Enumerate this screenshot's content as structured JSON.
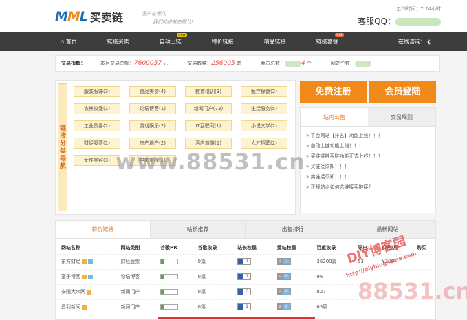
{
  "header": {
    "logo_mark": "MML",
    "logo_text": "买卖链",
    "slogan_line1": "客户在哪儿",
    "slogan_line2": "我们链接就在哪儿!",
    "worktime": "工作时间：7:24小时",
    "service_label": "客服QQ："
  },
  "nav": {
    "items": [
      {
        "label": "首页"
      },
      {
        "label": "链接买卖",
        "badge": ""
      },
      {
        "label": "自动上链",
        "badge": "new"
      },
      {
        "label": "特价链接"
      },
      {
        "label": "精品链接"
      },
      {
        "label": "链接套餐",
        "badge": "hot"
      }
    ],
    "online_consult": "在线咨询："
  },
  "stats": {
    "label": "交易指数：",
    "total_label": "本月交易总额：",
    "total_value": "7600057",
    "total_unit": "元",
    "count_label": "交易数量：",
    "count_value": "256005",
    "count_unit": "笔",
    "members_label": "会员总数：",
    "members_value": "4",
    "members_unit": "个",
    "sites_label": "网站个数："
  },
  "categories": {
    "label": "链接分类导航",
    "items": [
      "服装服饰(3)",
      "食品美食(4)",
      "教育培训(3)",
      "医疗保健(2)",
      "农林牧渔(1)",
      "论坛博客(1)",
      "新闻门户(73)",
      "生活服务(5)",
      "工业贸易(2)",
      "游戏娱乐(2)",
      "IT互联网(1)",
      "小说文学(2)",
      "财经股票(1)",
      "房产地产(2)",
      "酒店旅游(1)",
      "人才招聘(2)",
      "女性美容(3)",
      "电影影视(1)"
    ]
  },
  "auth": {
    "register": "免费注册",
    "login": "会员登陆"
  },
  "notice": {
    "tabs": [
      "站内公告",
      "交易规则"
    ],
    "items": [
      "平台网站【排名】功能上线！！！",
      "自动上链功能上线！！！",
      "买链链链买链功能正式上线！！！",
      "买链接须知！！！",
      "卖链接须知！！！",
      "正规站点如何选链接买链接？"
    ]
  },
  "panel": {
    "tabs": [
      "特价链接",
      "站长推荐",
      "出售排行",
      "最新网站"
    ],
    "columns": [
      "网站名称",
      "网站类别",
      "谷歌PR",
      "谷歌收录",
      "站长权重",
      "爱站权重",
      "百度收录",
      "导出",
      "价格/月",
      "购买"
    ],
    "rows": [
      {
        "name": "东方财经",
        "category": "财经股票",
        "google_index": "0篇",
        "zz_weight": "1",
        "az_weight": "2",
        "baidu": "36200篇",
        "out": "53",
        "price": "¥300"
      },
      {
        "name": "蛮子博客",
        "category": "论坛博客",
        "google_index": "0篇",
        "zz_weight": "1",
        "az_weight": "0",
        "baidu": "96",
        "out": "",
        "price": ""
      },
      {
        "name": "安阳大众网",
        "category": "新闻门户",
        "google_index": "0篇",
        "zz_weight": "0",
        "az_weight": "0",
        "baidu": "827",
        "out": "",
        "price": ""
      },
      {
        "name": "昌利新闻",
        "category": "新闻门户",
        "google_index": "0篇",
        "zz_weight": "1",
        "az_weight": "0",
        "baidu": "63篇",
        "out": "",
        "price": ""
      }
    ]
  },
  "watermark": {
    "text": "www.88531.cn",
    "text2": "88531.cn",
    "stamp_main": "DIY博客园",
    "stamp_url": "http://diyblogsome.com"
  },
  "colors": {
    "accent": "#f28a1b",
    "nav_bg": "#3d3d3d",
    "brand": "#1f6fb8"
  }
}
